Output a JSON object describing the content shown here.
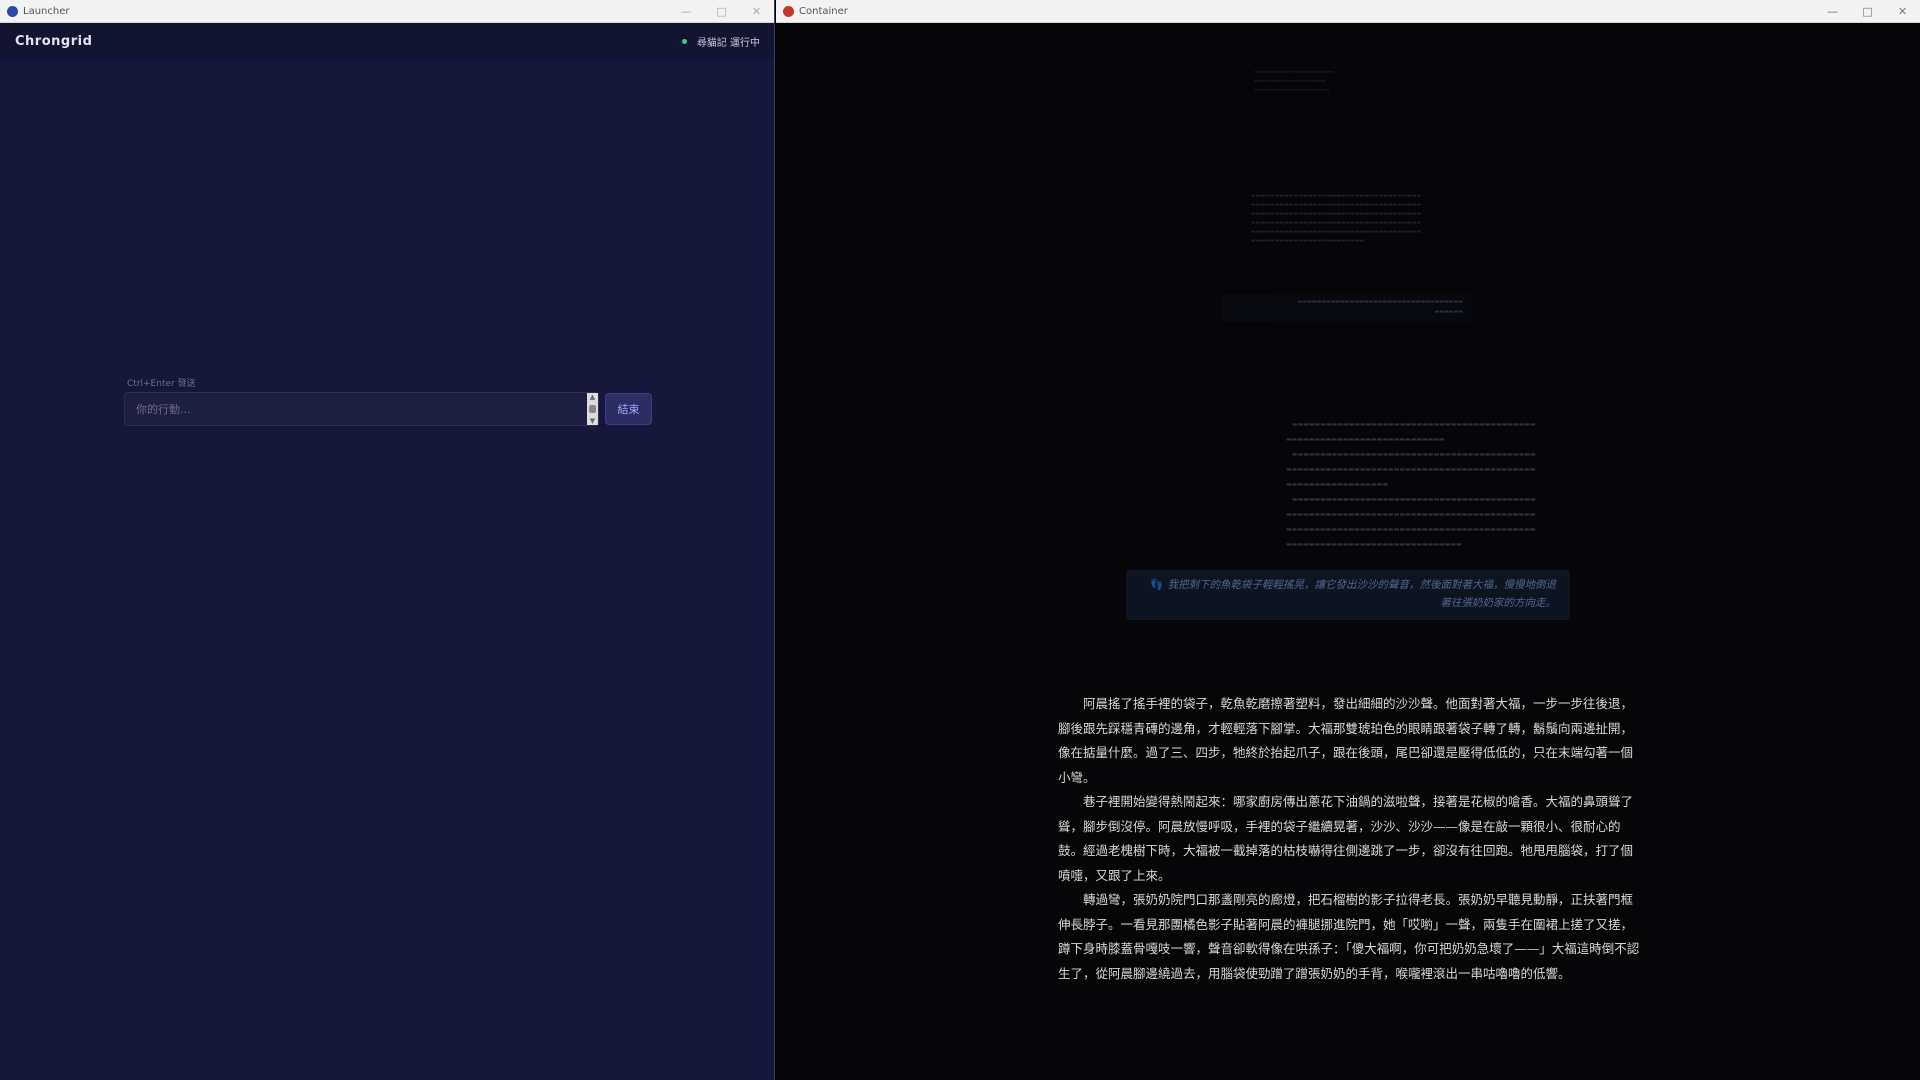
{
  "launcher": {
    "window_title": "Launcher",
    "brand": "Chrongrid",
    "status_text": "尋貓記 運行中",
    "hint": "Ctrl+Enter 發送",
    "input_placeholder": "你的行動...",
    "end_button": "結束",
    "controls": {
      "minimize": "—",
      "maximize": "□",
      "close": "✕"
    }
  },
  "container": {
    "window_title": "Container",
    "controls": {
      "minimize": "—",
      "maximize": "□",
      "close": "✕"
    },
    "prev_action": "我把剩下的魚乾袋子輕輕搖晃，讓它發出沙沙的聲音，然後面對著大福，慢慢地倒退著往張奶奶家的方向走。",
    "action_icon": "footprint-icon",
    "story": [
      "阿晨搖了搖手裡的袋子，乾魚乾磨擦著塑料，發出細細的沙沙聲。他面對著大福，一步一步往後退，腳後跟先踩穩青磚的邊角，才輕輕落下腳掌。大福那雙琥珀色的眼睛跟著袋子轉了轉，鬍鬚向兩邊扯開，像在掂量什麼。過了三、四步，牠終於抬起爪子，跟在後頭，尾巴卻還是壓得低低的，只在末端勾著一個小彎。",
      "巷子裡開始變得熱鬧起來：哪家廚房傳出蔥花下油鍋的滋啦聲，接著是花椒的嗆香。大福的鼻頭聳了聳，腳步倒沒停。阿晨放慢呼吸，手裡的袋子繼續晃著，沙沙、沙沙——像是在敲一顆很小、很耐心的鼓。經過老槐樹下時，大福被一截掉落的枯枝嚇得往側邊跳了一步，卻沒有往回跑。牠甩甩腦袋，打了個噴嚏，又跟了上來。",
      "轉過彎，張奶奶院門口那盞剛亮的廊燈，把石榴樹的影子拉得老長。張奶奶早聽見動靜，正扶著門框伸長脖子。一看見那團橘色影子貼著阿晨的褲腿挪進院門，她「哎喲」一聲，兩隻手在圍裙上搓了又搓，蹲下身時膝蓋骨嘎吱一響，聲音卻軟得像在哄孫子：「傻大福啊，你可把奶奶急壞了——」大福這時倒不認生了，從阿晨腳邊繞過去，用腦袋使勁蹭了蹭張奶奶的手背，喉嚨裡滾出一串咕嚕嚕的低響。"
    ]
  }
}
